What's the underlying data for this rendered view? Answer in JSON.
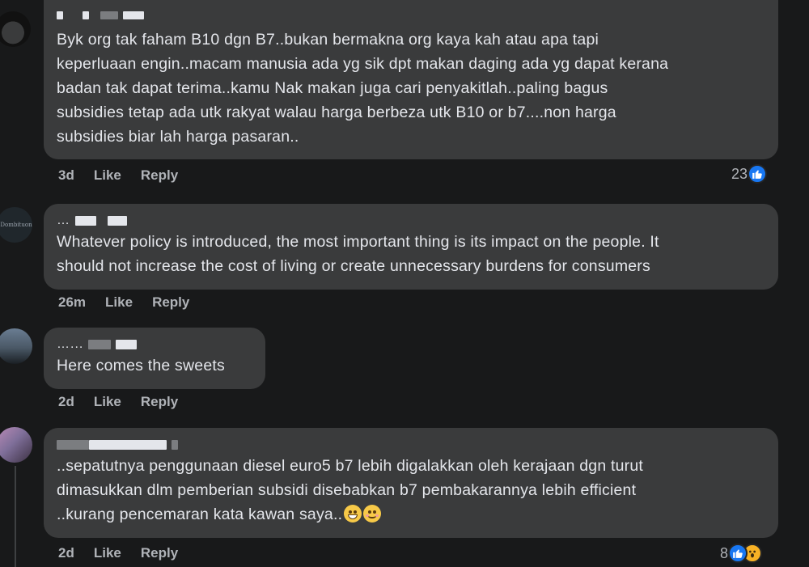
{
  "comments": [
    {
      "text": "Byk org tak faham B10 dgn B7..bukan bermakna org kaya kah atau apa tapi\nkeperluaan engin..macam manusia ada yg sik dpt makan daging ada yg dapat kerana\nbadan tak dapat terima..kamu Nak makan juga cari penyakitlah..paling bagus\nsubsidies tetap ada utk rakyat walau harga berbeza utk B10 or b7....non harga\nsubsidies biar lah harga pasaran..",
      "time": "3d",
      "like": "Like",
      "reply": "Reply",
      "reaction_count": "23",
      "reaction_icons": [
        "like-icon"
      ]
    },
    {
      "avatar_text": "Dombituon",
      "author_prefix": "…",
      "text": "Whatever policy is introduced, the most important thing is its impact on the people. It\nshould not increase the cost of living or create unnecessary burdens for consumers",
      "time": "26m",
      "like": "Like",
      "reply": "Reply"
    },
    {
      "author_prefix": "…...",
      "text": "Here comes the sweets",
      "time": "2d",
      "like": "Like",
      "reply": "Reply"
    },
    {
      "text": "..sepatutnya penggunaan diesel euro5 b7 lebih digalakkan oleh kerajaan dgn turut\ndimasukkan dlm pemberian subsidi disebabkan b7 pembakarannya lebih efficient\n..kurang pencemaran kata kawan saya..",
      "time": "2d",
      "like": "Like",
      "reply": "Reply",
      "reaction_count": "8",
      "reaction_icons": [
        "like-icon",
        "wow-icon"
      ],
      "emojis": [
        "grin-icon",
        "smile-icon"
      ]
    }
  ],
  "colors": {
    "background": "#18191a",
    "bubble": "#3a3b3c",
    "text": "#e4e6eb",
    "meta": "#b0b3b8",
    "like_blue": "#1877f2"
  }
}
